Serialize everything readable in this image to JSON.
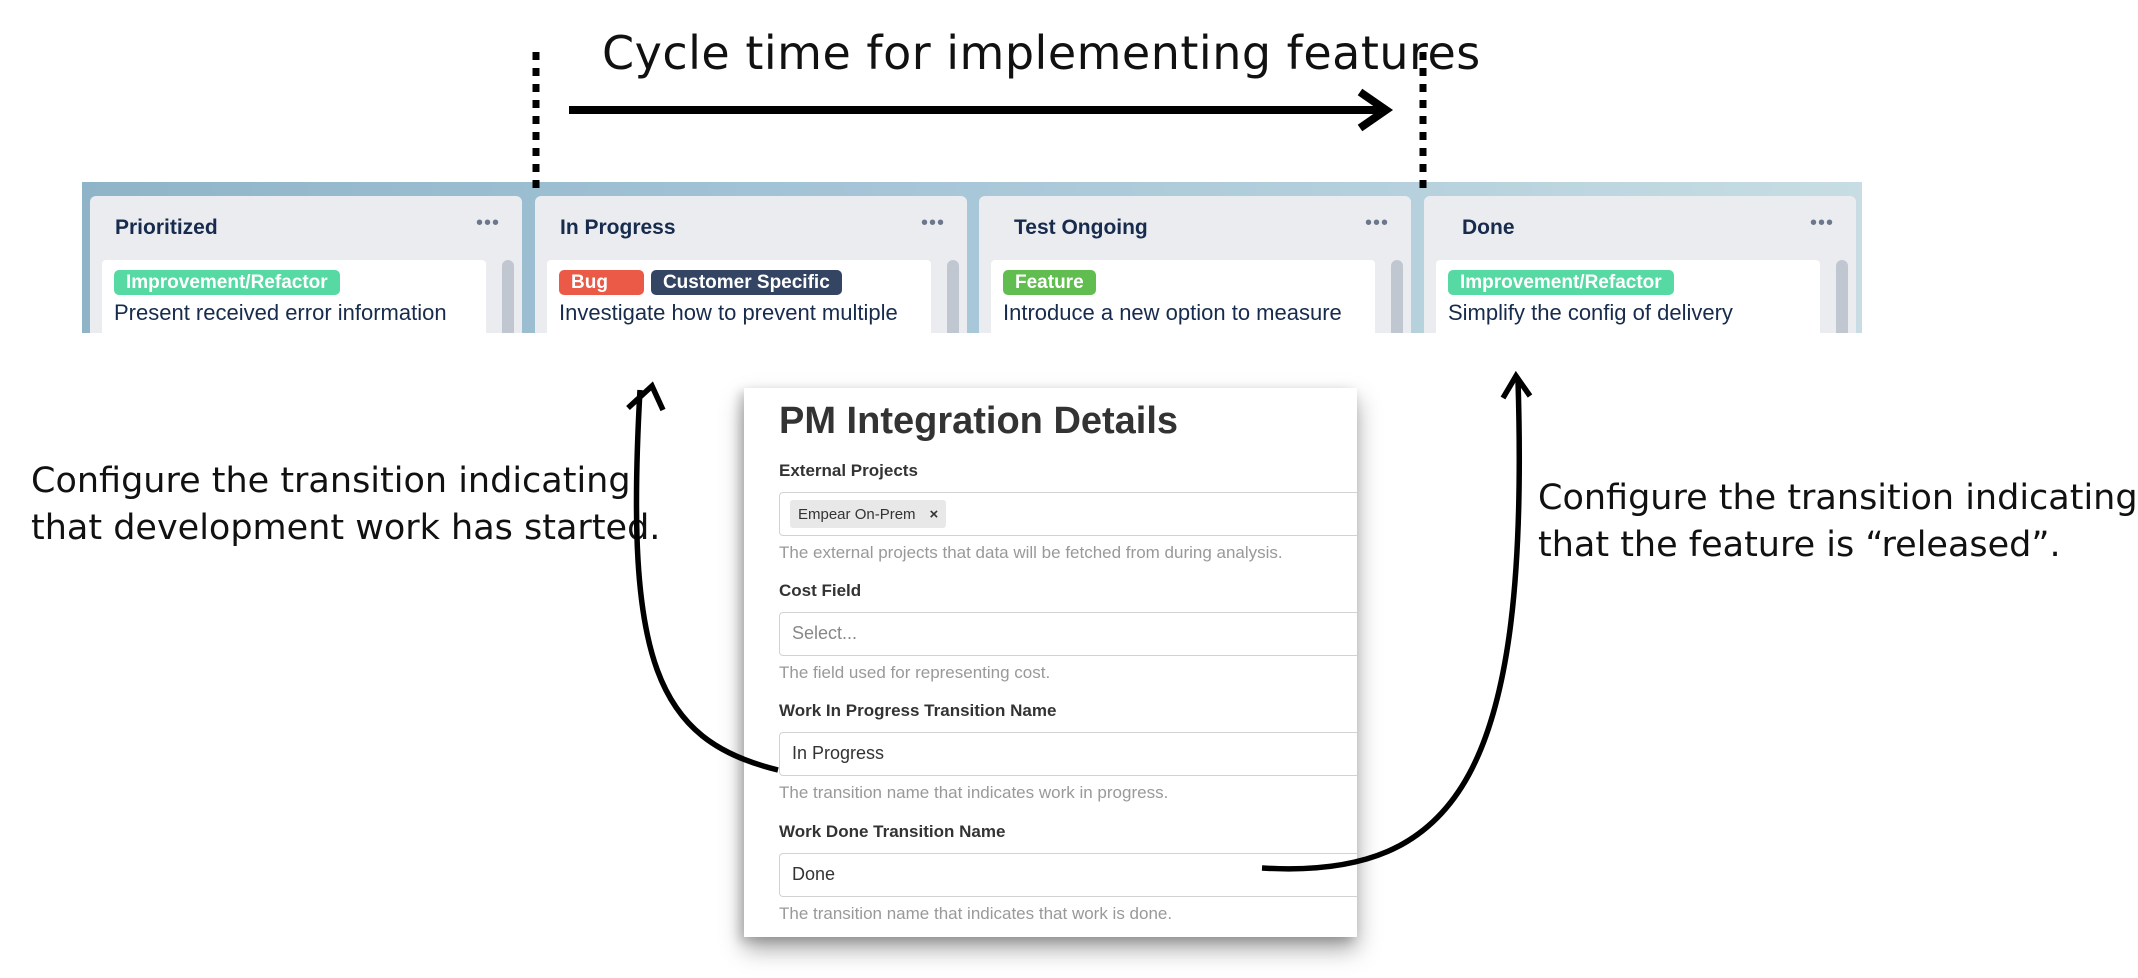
{
  "diagram": {
    "title": "Cycle time for implementing features",
    "annotation_left": [
      "Configure the transition indicating",
      "that development work has started."
    ],
    "annotation_right": [
      "Configure the transition indicating",
      "that the feature is “released”."
    ],
    "colors": {
      "ink": "#000000"
    }
  },
  "board": {
    "columns": [
      {
        "title": "Prioritized",
        "menu": "•••",
        "card": {
          "tags": [
            {
              "label": "Improvement/Refactor",
              "color": "#57d9a3"
            }
          ],
          "text": "Present received error information"
        }
      },
      {
        "title": "In Progress",
        "menu": "•••",
        "card": {
          "tags": [
            {
              "label": "Bug",
              "color": "#eb5a46"
            },
            {
              "label": "Customer Specific",
              "color": "#344563"
            }
          ],
          "text": "Investigate how to prevent multiple"
        }
      },
      {
        "title": "Test Ongoing",
        "menu": "•••",
        "card": {
          "tags": [
            {
              "label": "Feature",
              "color": "#61bd4f"
            }
          ],
          "text": "Introduce a new option to measure"
        }
      },
      {
        "title": "Done",
        "menu": "•••",
        "card": {
          "tags": [
            {
              "label": "Improvement/Refactor",
              "color": "#57d9a3"
            }
          ],
          "text": "Simplify the config of delivery"
        }
      }
    ]
  },
  "panel": {
    "title": "PM Integration Details",
    "external_projects": {
      "label": "External Projects",
      "chip": "Empear On-Prem",
      "chip_remove": "×",
      "help": "The external projects that data will be fetched from during analysis."
    },
    "cost_field": {
      "label": "Cost Field",
      "placeholder": "Select...",
      "help": "The field used for representing cost."
    },
    "wip_transition": {
      "label": "Work In Progress Transition Name",
      "value": "In Progress",
      "help": "The transition name that indicates work in progress."
    },
    "done_transition": {
      "label": "Work Done Transition Name",
      "value": "Done",
      "help": "The transition name that indicates that work is done."
    }
  }
}
